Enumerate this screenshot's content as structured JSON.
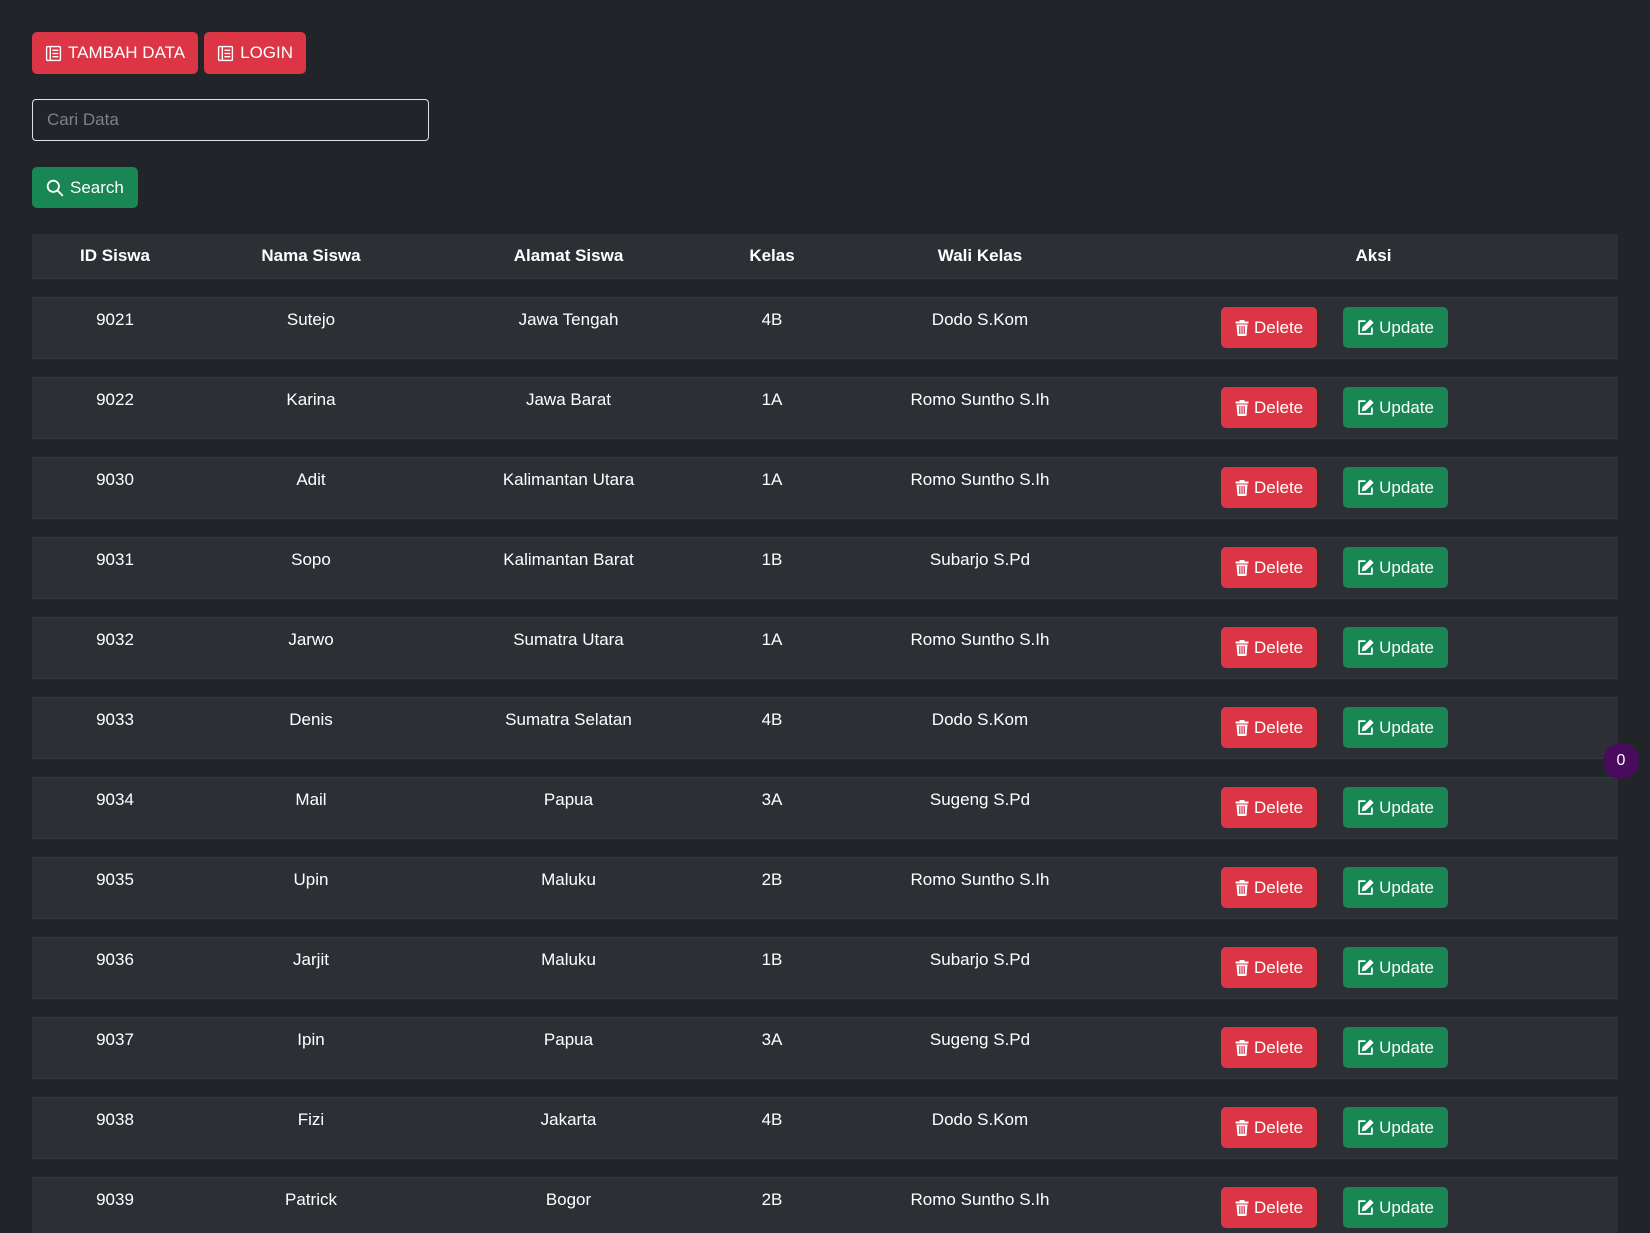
{
  "toolbar": {
    "tambah_label": "TAMBAH DATA",
    "login_label": "LOGIN"
  },
  "search": {
    "placeholder": "Cari Data",
    "value": "",
    "button_label": "Search"
  },
  "table": {
    "headers": {
      "id": "ID Siswa",
      "nama": "Nama Siswa",
      "alamat": "Alamat Siswa",
      "kelas": "Kelas",
      "wali": "Wali Kelas",
      "aksi": "Aksi"
    },
    "delete_label": "Delete",
    "update_label": "Update",
    "rows": [
      {
        "id": "9021",
        "nama": "Sutejo",
        "alamat": "Jawa Tengah",
        "kelas": "4B",
        "wali": "Dodo S.Kom"
      },
      {
        "id": "9022",
        "nama": "Karina",
        "alamat": "Jawa Barat",
        "kelas": "1A",
        "wali": "Romo Suntho S.Ih"
      },
      {
        "id": "9030",
        "nama": "Adit",
        "alamat": "Kalimantan Utara",
        "kelas": "1A",
        "wali": "Romo Suntho S.Ih"
      },
      {
        "id": "9031",
        "nama": "Sopo",
        "alamat": "Kalimantan Barat",
        "kelas": "1B",
        "wali": "Subarjo S.Pd"
      },
      {
        "id": "9032",
        "nama": "Jarwo",
        "alamat": "Sumatra Utara",
        "kelas": "1A",
        "wali": "Romo Suntho S.Ih"
      },
      {
        "id": "9033",
        "nama": "Denis",
        "alamat": "Sumatra Selatan",
        "kelas": "4B",
        "wali": "Dodo S.Kom"
      },
      {
        "id": "9034",
        "nama": "Mail",
        "alamat": "Papua",
        "kelas": "3A",
        "wali": "Sugeng S.Pd"
      },
      {
        "id": "9035",
        "nama": "Upin",
        "alamat": "Maluku",
        "kelas": "2B",
        "wali": "Romo Suntho S.Ih"
      },
      {
        "id": "9036",
        "nama": "Jarjit",
        "alamat": "Maluku",
        "kelas": "1B",
        "wali": "Subarjo S.Pd"
      },
      {
        "id": "9037",
        "nama": "Ipin",
        "alamat": "Papua",
        "kelas": "3A",
        "wali": "Sugeng S.Pd"
      },
      {
        "id": "9038",
        "nama": "Fizi",
        "alamat": "Jakarta",
        "kelas": "4B",
        "wali": "Dodo S.Kom"
      },
      {
        "id": "9039",
        "nama": "Patrick",
        "alamat": "Bogor",
        "kelas": "2B",
        "wali": "Romo Suntho S.Ih"
      }
    ]
  },
  "badge": {
    "count": "0"
  },
  "colors": {
    "background": "#212529",
    "row": "#2c3034",
    "danger": "#dc3545",
    "success": "#198754",
    "badge": "#4a0a5e"
  },
  "icons": {
    "tambah": "list-icon",
    "login": "list-icon",
    "search": "search-icon",
    "delete": "trash-icon",
    "update": "edit-icon"
  }
}
